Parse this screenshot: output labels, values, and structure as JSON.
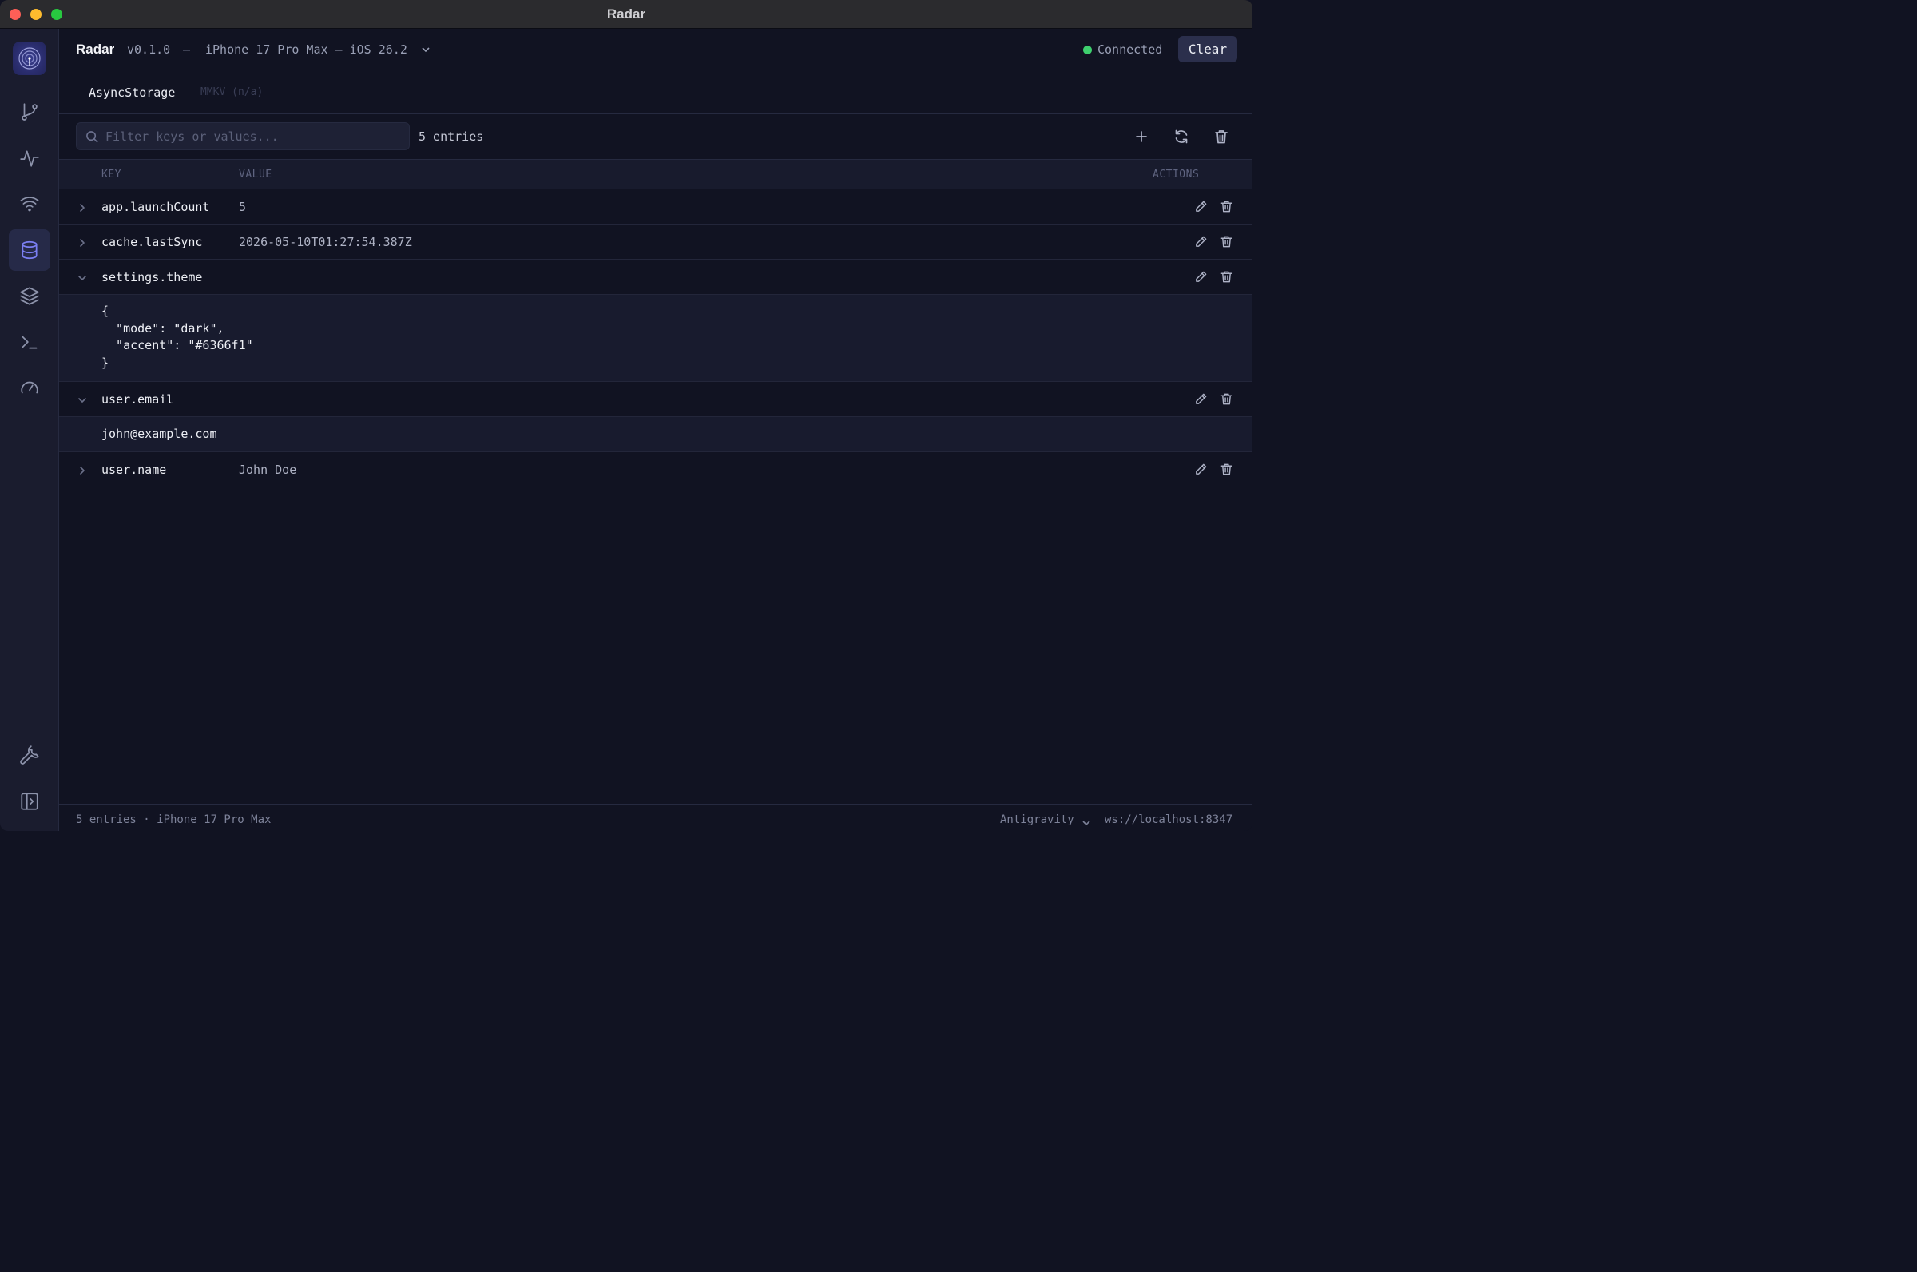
{
  "window": {
    "title": "Radar"
  },
  "header": {
    "app_name": "Radar",
    "version": "v0.1.0",
    "separator": "—",
    "device": "iPhone 17 Pro Max — iOS 26.2",
    "status": "Connected",
    "status_color": "#3ecf6e",
    "clear_label": "Clear"
  },
  "sidebar": {
    "items": [
      {
        "name": "git-branch-icon"
      },
      {
        "name": "activity-icon"
      },
      {
        "name": "wifi-icon"
      },
      {
        "name": "database-icon",
        "active": true
      },
      {
        "name": "layers-icon"
      },
      {
        "name": "terminal-icon"
      },
      {
        "name": "gauge-icon"
      },
      {
        "name": "wrench-icon"
      },
      {
        "name": "sidebar-toggle-icon"
      }
    ],
    "accent": "#7b7ff2"
  },
  "tabs": [
    {
      "label": "AsyncStorage",
      "active": true
    },
    {
      "label": "MMKV (n/a)",
      "disabled": true
    }
  ],
  "toolbar": {
    "search_placeholder": "Filter keys or values...",
    "search_value": "",
    "entry_count": "5 entries"
  },
  "table": {
    "headers": {
      "key": "KEY",
      "value": "VALUE",
      "actions": "ACTIONS"
    },
    "rows": [
      {
        "key": "app.launchCount",
        "value": "5",
        "expanded": false
      },
      {
        "key": "cache.lastSync",
        "value": "2026-05-10T01:27:54.387Z",
        "expanded": false
      },
      {
        "key": "settings.theme",
        "value": "",
        "expanded": true,
        "detail": "{\n  \"mode\": \"dark\",\n  \"accent\": \"#6366f1\"\n}"
      },
      {
        "key": "user.email",
        "value": "",
        "expanded": true,
        "detail": "john@example.com"
      },
      {
        "key": "user.name",
        "value": "John Doe",
        "expanded": false
      }
    ]
  },
  "statusbar": {
    "left": "5 entries · iPhone 17 Pro Max",
    "editor": "Antigravity",
    "socket": "ws://localhost:8347"
  }
}
